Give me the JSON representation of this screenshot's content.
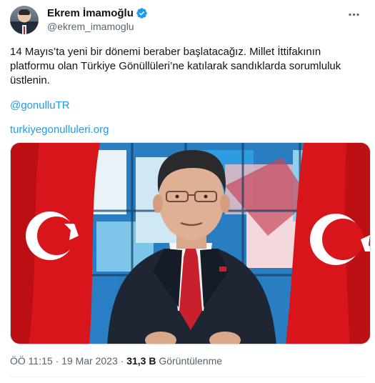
{
  "author": {
    "display_name": "Ekrem İmamoğlu",
    "handle": "@ekrem_imamoglu",
    "verified": true,
    "verified_badge_color": "#1d9bf0"
  },
  "tweet": {
    "text": "14 Mayıs’ta yeni bir dönemi beraber başlatacağız. Millet İttifakının platformu olan Türkiye Gönüllüleri’ne katılarak sandıklarda sorumluluk üstlenin.",
    "mention": "@gonulluTR",
    "url_text": "turkiyegonulluleri.org",
    "link_color": "#1d9bf0"
  },
  "meta": {
    "time": "ÖÖ 11:15",
    "separator": "·",
    "date": "19 Mar 2023",
    "views_count": "31,3 B",
    "views_label": "Görüntülenme"
  },
  "icons": {
    "more": "more-horizontal-icon",
    "verified": "verified-badge-icon"
  }
}
